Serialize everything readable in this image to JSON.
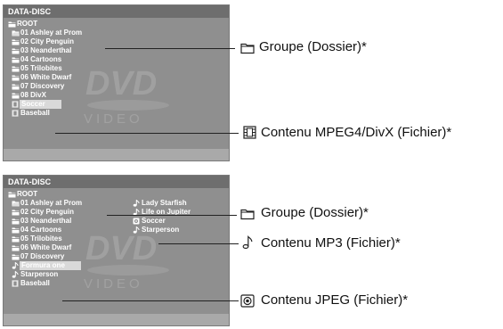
{
  "screen1": {
    "title": "DATA-DISC",
    "root": "ROOT",
    "items": [
      {
        "label": "01 Ashley at Prom",
        "icon": "folder-open-icon"
      },
      {
        "label": "02 City Penguin",
        "icon": "folder-icon"
      },
      {
        "label": "03 Neanderthal",
        "icon": "folder-icon"
      },
      {
        "label": "04 Cartoons",
        "icon": "folder-icon"
      },
      {
        "label": "05 Trilobites",
        "icon": "folder-icon"
      },
      {
        "label": "06 White Dwarf",
        "icon": "folder-icon"
      },
      {
        "label": "07 Discovery",
        "icon": "folder-icon"
      },
      {
        "label": "08 DivX",
        "icon": "folder-icon"
      },
      {
        "label": "Soccer",
        "icon": "film-icon",
        "highlighted": true
      },
      {
        "label": "Baseball",
        "icon": "film-icon"
      }
    ],
    "watermark_text": "VIDEO"
  },
  "screen2": {
    "title": "DATA-DISC",
    "root": "ROOT",
    "left_items": [
      {
        "label": "01 Ashley at Prom",
        "icon": "folder-open-icon"
      },
      {
        "label": "02 City Penguin",
        "icon": "folder-icon"
      },
      {
        "label": "03 Neanderthal",
        "icon": "folder-icon"
      },
      {
        "label": "04 Cartoons",
        "icon": "folder-icon"
      },
      {
        "label": "05 Trilobites",
        "icon": "folder-icon"
      },
      {
        "label": "06 White Dwarf",
        "icon": "folder-icon"
      },
      {
        "label": "07 Discovery",
        "icon": "folder-icon"
      },
      {
        "label": "Formura one",
        "icon": "note-icon",
        "highlighted": true
      },
      {
        "label": "Starperson",
        "icon": "note-icon"
      },
      {
        "label": "Baseball",
        "icon": "film-icon"
      }
    ],
    "right_items": [
      {
        "label": "Lady Starfish",
        "icon": "note-icon"
      },
      {
        "label": "Life on Jupiter",
        "icon": "note-icon"
      },
      {
        "label": "Soccer",
        "icon": "camera-icon"
      },
      {
        "label": "Starperson",
        "icon": "note-icon"
      }
    ],
    "watermark_text": "VIDEO"
  },
  "callouts": {
    "group1": "Groupe (Dossier)*",
    "mpeg4": "Contenu MPEG4/DivX (Fichier)*",
    "group2": "Groupe (Dossier)*",
    "mp3": "Contenu MP3 (Fichier)*",
    "jpeg": "Contenu JPEG (Fichier)*"
  }
}
